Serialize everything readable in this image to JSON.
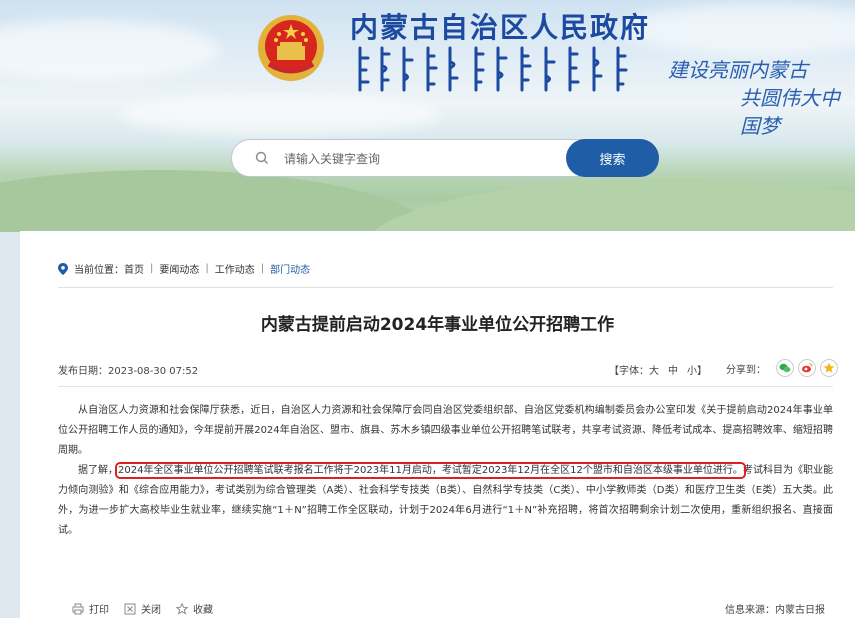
{
  "header": {
    "site_title": "内蒙古自治区人民政府",
    "slogan_line1": "建设亮丽内蒙古",
    "slogan_line2": "共圆伟大中国梦"
  },
  "search": {
    "placeholder": "请输入关键字查询",
    "button_label": "搜索"
  },
  "breadcrumb": {
    "prefix": "当前位置：",
    "items": [
      "首页",
      "要闻动态",
      "工作动态",
      "部门动态"
    ],
    "separator": "|"
  },
  "article": {
    "title": "内蒙古提前启动2024年事业单位公开招聘工作",
    "date_label": "发布日期：",
    "date": "2023-08-30 07:52",
    "font_size_label": "【字体：",
    "font_sizes": [
      "大",
      "中",
      "小"
    ],
    "font_size_close": "】",
    "share_label": "分享到：",
    "share_icons": [
      "wechat-icon",
      "weibo-icon",
      "qzone-icon"
    ],
    "paragraph1": "从自治区人力资源和社会保障厅获悉，近日，自治区人力资源和社会保障厅会同自治区党委组织部、自治区党委机构编制委员会办公室印发《关于提前启动2024年事业单位公开招聘工作人员的通知》，今年提前开展2024年自治区、盟市、旗县、苏木乡镇四级事业单位公开招聘笔试联考，共享考试资源、降低考试成本、提高招聘效率、缩短招聘周期。",
    "paragraph2_lead": "据了解，",
    "paragraph2_highlight": "2024年全区事业单位公开招聘笔试联考报名工作将于2023年11月启动，考试暂定2023年12月在全区12个盟市和自治区本级事业单位进行。",
    "paragraph2_rest": "考试科目为《职业能力倾向测验》和《综合应用能力》，考试类别为综合管理类（A类）、社会科学专技类（B类）、自然科学专技类（C类）、中小学教师类（D类）和医疗卫生类（E类）五大类。此外，为进一步扩大高校毕业生就业率，继续实施“1＋N”招聘工作全区联动，计划于2024年6月进行“1＋N”补充招聘，将首次招聘剩余计划二次使用，重新组织报名、直接面试。"
  },
  "footer": {
    "print_label": "打印",
    "close_label": "关闭",
    "favorite_label": "收藏",
    "source": "信息来源：内蒙古日报"
  },
  "colors": {
    "brand_blue": "#1f5da6",
    "title_blue": "#1b4aa0",
    "highlight_red": "#e02020"
  }
}
